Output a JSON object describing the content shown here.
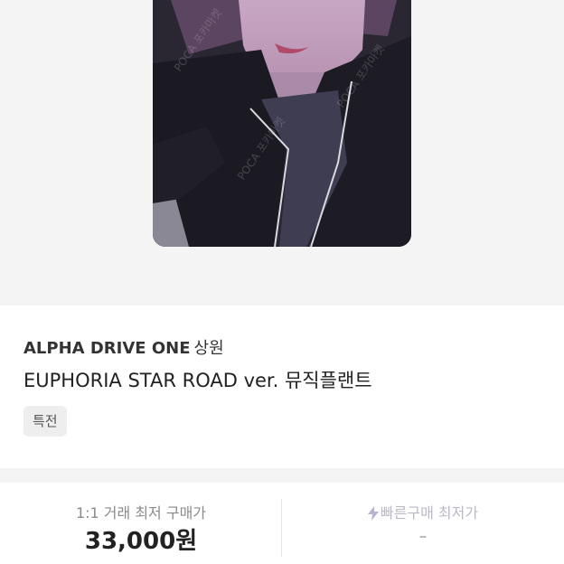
{
  "product": {
    "artist": "ALPHA DRIVE ONE",
    "member": "상원",
    "album": "EUPHORIA STAR ROAD ver. 뮤직플랜트",
    "tag": "특전",
    "watermark": "POCA 포카마켓"
  },
  "prices": {
    "direct_label": "1:1 거래 최저 구매가",
    "direct_value": "33,000원",
    "quick_label": "빠른구매 최저가",
    "quick_value": "-",
    "quick_icon": "lightning-bolt-icon"
  },
  "colors": {
    "quick_accent": "#b6b3d6"
  }
}
